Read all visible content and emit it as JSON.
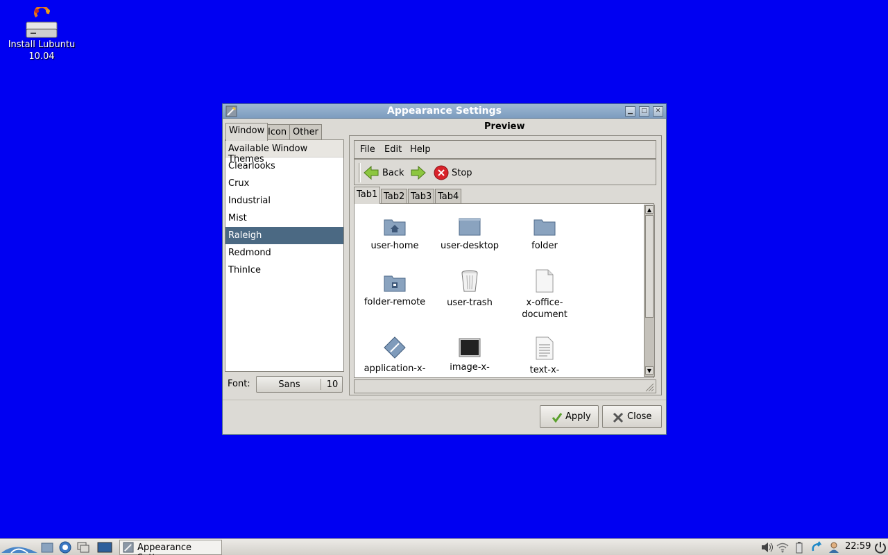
{
  "desktop": {
    "icons": [
      {
        "label_line1": "Install Lubuntu",
        "label_line2": "10.04",
        "icon": "install-drive-icon"
      }
    ]
  },
  "window": {
    "title": "Appearance Settings",
    "left_tabs": [
      "Window",
      "Icon",
      "Other"
    ],
    "active_left_tab": "Window",
    "themes_header": "Available Window Themes",
    "themes": [
      "Clearlooks",
      "Crux",
      "Industrial",
      "Mist",
      "Raleigh",
      "Redmond",
      "ThinIce"
    ],
    "selected_theme": "Raleigh",
    "font_label": "Font:",
    "font_name": "Sans",
    "font_size": "10",
    "preview_title": "Preview",
    "preview": {
      "menu": [
        "File",
        "Edit",
        "Help"
      ],
      "toolbar": {
        "back": "Back",
        "stop": "Stop"
      },
      "tabs": [
        "Tab1",
        "Tab2",
        "Tab3",
        "Tab4"
      ],
      "active_tab": "Tab1",
      "icons": [
        {
          "label": "user-home",
          "icon": "user-home-icon"
        },
        {
          "label": "user-desktop",
          "icon": "user-desktop-icon"
        },
        {
          "label": "folder",
          "icon": "folder-icon"
        },
        {
          "label": "folder-remote",
          "icon": "folder-remote-icon"
        },
        {
          "label": "user-trash",
          "icon": "user-trash-icon"
        },
        {
          "label": "x-office-document",
          "label_line1": "x-office-",
          "label_line2": "document",
          "icon": "x-office-document-icon"
        },
        {
          "label": "application-x-",
          "icon": "application-x-icon"
        },
        {
          "label": "image-x-",
          "icon": "image-x-icon"
        },
        {
          "label": "text-x-",
          "icon": "text-x-icon"
        }
      ]
    },
    "buttons": {
      "apply": "Apply",
      "close": "Close"
    }
  },
  "taskbar": {
    "task_label": "Appearance Sett...",
    "clock": "22:59"
  },
  "colors": {
    "desktop_bg": "#0000f2",
    "selection": "#4b6983",
    "titlebar": "#8aa7c6"
  }
}
